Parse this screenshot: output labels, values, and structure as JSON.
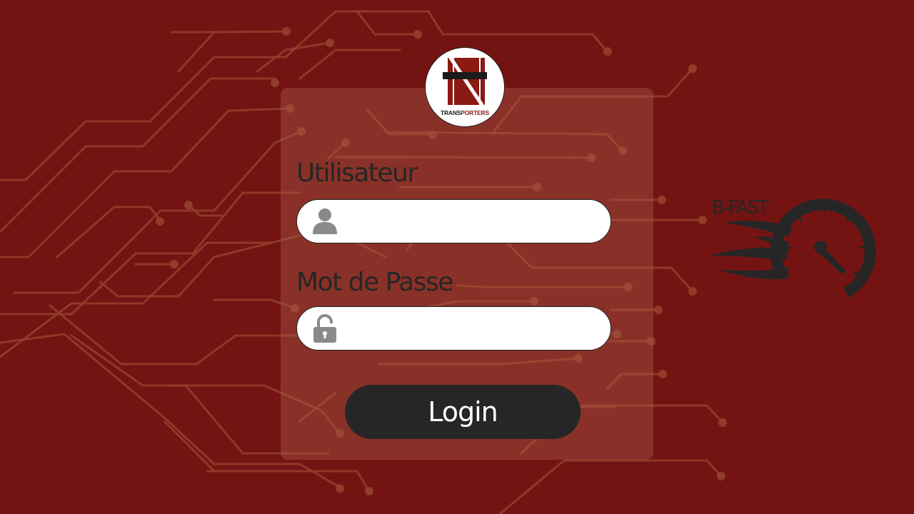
{
  "logo": {
    "icon": "transporters-logo",
    "text_part1": "TRANS",
    "text_part2": "PORTERS",
    "colors": {
      "red": "#8b1a12",
      "dark": "#1b1b1b"
    }
  },
  "form": {
    "username_label": "Utilisateur",
    "username_value": "",
    "username_icon": "user-icon",
    "password_label": "Mot de Passe",
    "password_value": "",
    "password_icon": "lock-icon",
    "login_button": "Login"
  },
  "brand": {
    "name": "B-FAST",
    "icon": "speedometer-icon"
  },
  "colors": {
    "background": "#731413",
    "circuit": "#93402c",
    "panel": "rgba(170,90,70,0.42)",
    "button": "#262626",
    "text_dark": "#262626"
  }
}
